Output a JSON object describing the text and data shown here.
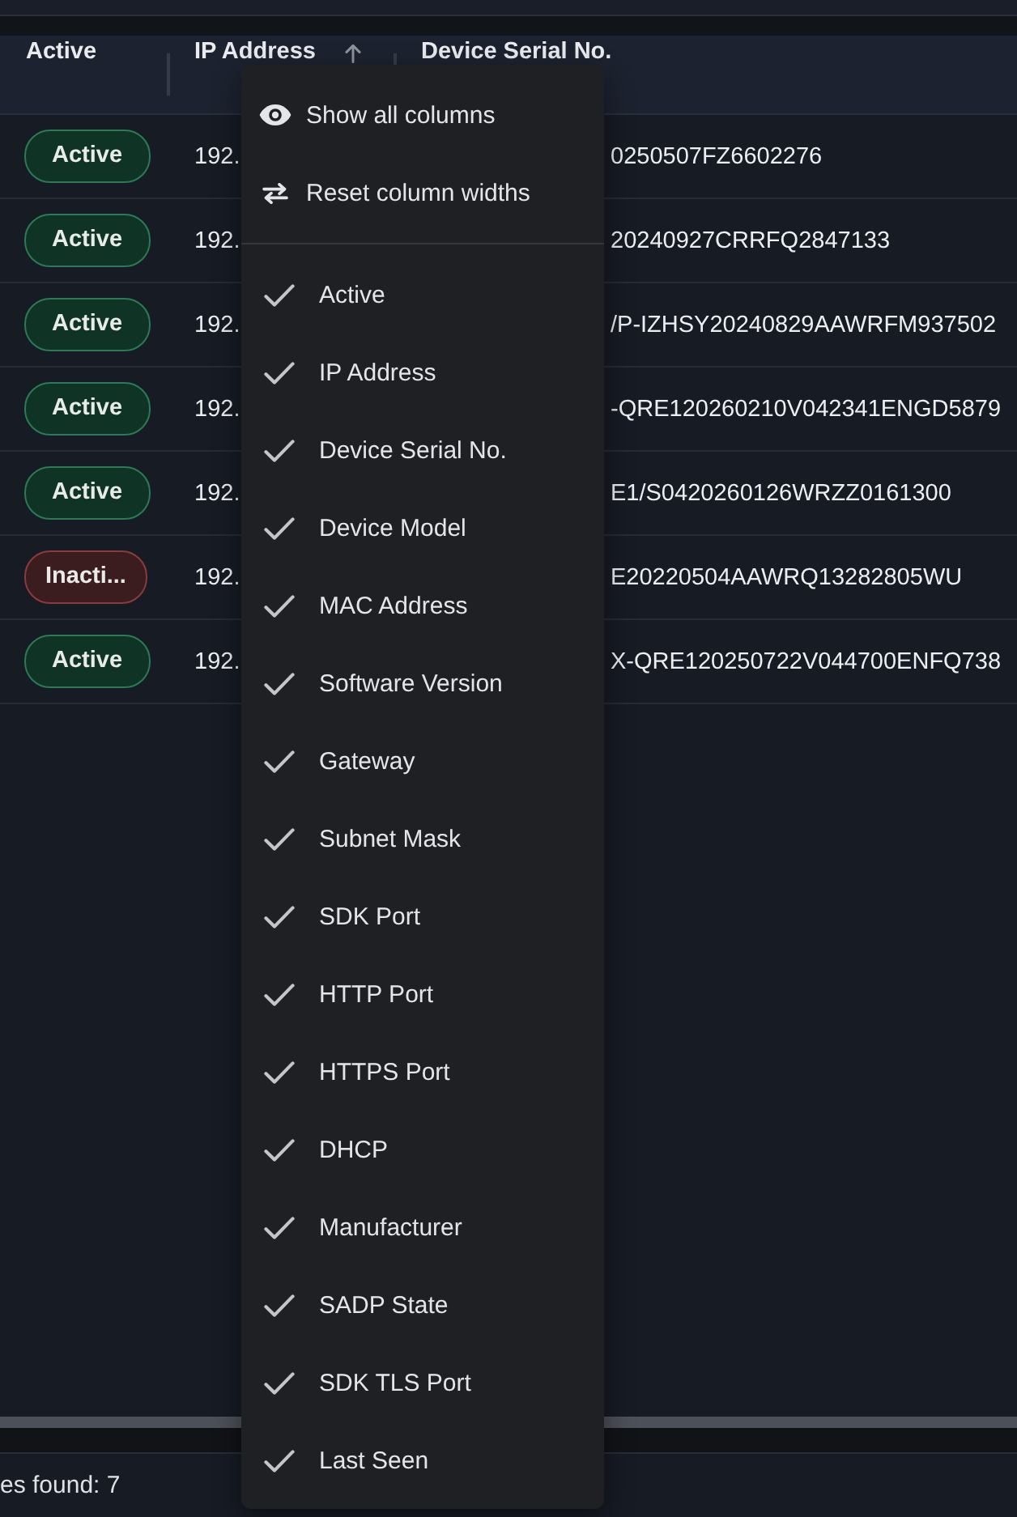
{
  "table": {
    "columns": [
      {
        "label": "Active",
        "sorted": false
      },
      {
        "label": "IP Address",
        "sorted": true
      },
      {
        "label": "Device Serial No.",
        "sorted": false
      }
    ],
    "rows": [
      {
        "status": {
          "label": "Active",
          "kind": "active"
        },
        "ip": "192.",
        "serial": "0250507FZ6602276"
      },
      {
        "status": {
          "label": "Active",
          "kind": "active"
        },
        "ip": "192.",
        "serial": "20240927CRRFQ2847133"
      },
      {
        "status": {
          "label": "Active",
          "kind": "active"
        },
        "ip": "192.",
        "serial": "/P-IZHSY20240829AAWRFM937502"
      },
      {
        "status": {
          "label": "Active",
          "kind": "active"
        },
        "ip": "192.",
        "serial": "-QRE120260210V042341ENGD5879"
      },
      {
        "status": {
          "label": "Active",
          "kind": "active"
        },
        "ip": "192.",
        "serial": "E1/S0420260126WRZZ0161300"
      },
      {
        "status": {
          "label": "Inacti...",
          "kind": "inactive"
        },
        "ip": "192.",
        "serial": "E20220504AAWRQ13282805WU"
      },
      {
        "status": {
          "label": "Active",
          "kind": "active"
        },
        "ip": "192.",
        "serial": "X-QRE120250722V044700ENFQ738"
      }
    ]
  },
  "column_menu": {
    "actions": [
      {
        "label": "Show all columns",
        "kind": "show"
      },
      {
        "label": "Reset column widths",
        "kind": "reset"
      }
    ],
    "columns": [
      {
        "label": "Active",
        "checked": true
      },
      {
        "label": "IP Address",
        "checked": true
      },
      {
        "label": "Device Serial No.",
        "checked": true
      },
      {
        "label": "Device Model",
        "checked": true
      },
      {
        "label": "MAC Address",
        "checked": true
      },
      {
        "label": "Software Version",
        "checked": true
      },
      {
        "label": "Gateway",
        "checked": true
      },
      {
        "label": "Subnet Mask",
        "checked": true
      },
      {
        "label": "SDK Port",
        "checked": true
      },
      {
        "label": "HTTP Port",
        "checked": true
      },
      {
        "label": "HTTPS Port",
        "checked": true
      },
      {
        "label": "DHCP",
        "checked": true
      },
      {
        "label": "Manufacturer",
        "checked": true
      },
      {
        "label": "SADP State",
        "checked": true
      },
      {
        "label": "SDK TLS Port",
        "checked": true
      },
      {
        "label": "Last Seen",
        "checked": true
      }
    ]
  },
  "footer": {
    "text": "es found: 7"
  }
}
